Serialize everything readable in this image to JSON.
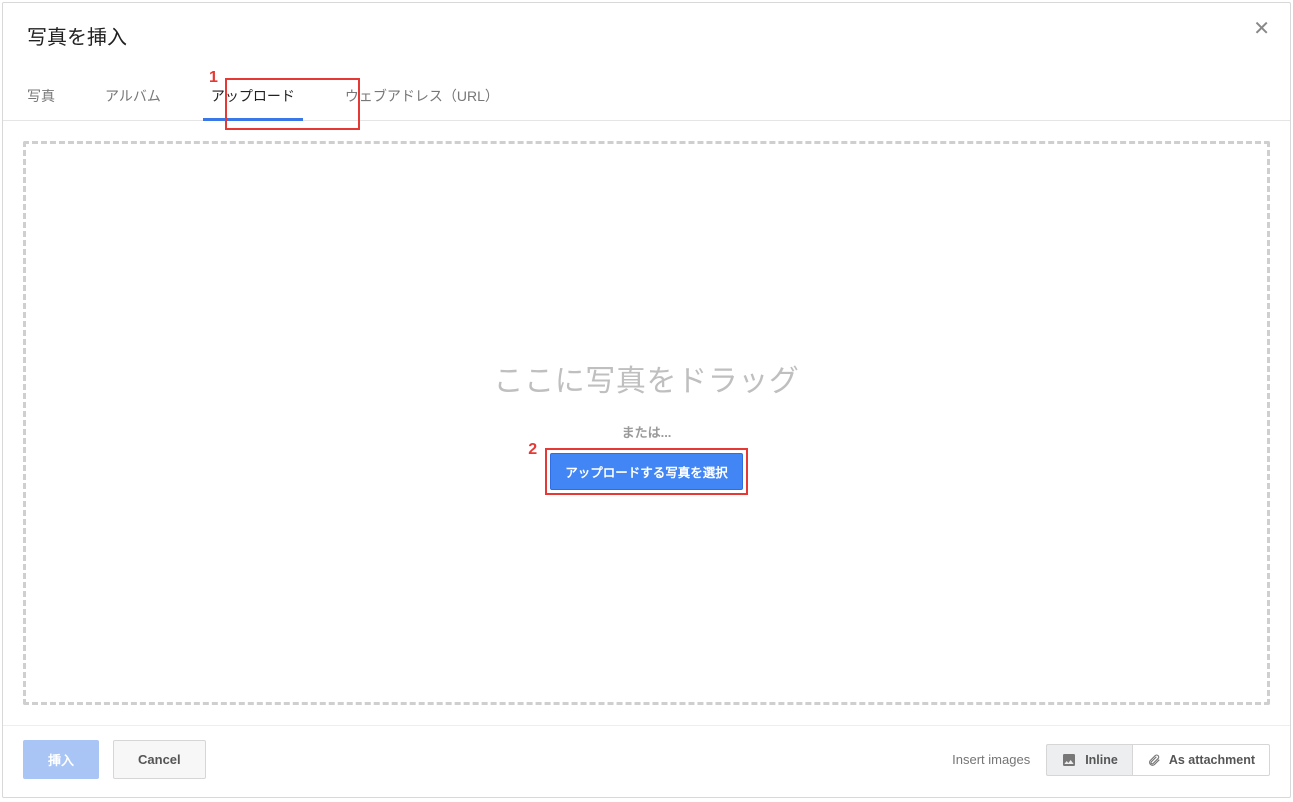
{
  "dialog": {
    "title": "写真を挿入",
    "close_glyph": "✕"
  },
  "tabs": {
    "photos": "写真",
    "albums": "アルバム",
    "upload": "アップロード",
    "url": "ウェブアドレス（URL）"
  },
  "dropzone": {
    "drag_text": "ここに写真をドラッグ",
    "or_text": "または...",
    "select_button": "アップロードする写真を選択"
  },
  "footer": {
    "insert": "挿入",
    "cancel": "Cancel",
    "insert_images_label": "Insert images",
    "inline": "Inline",
    "as_attachment": "As attachment"
  },
  "annotations": {
    "marker1": "1",
    "marker2": "2"
  }
}
